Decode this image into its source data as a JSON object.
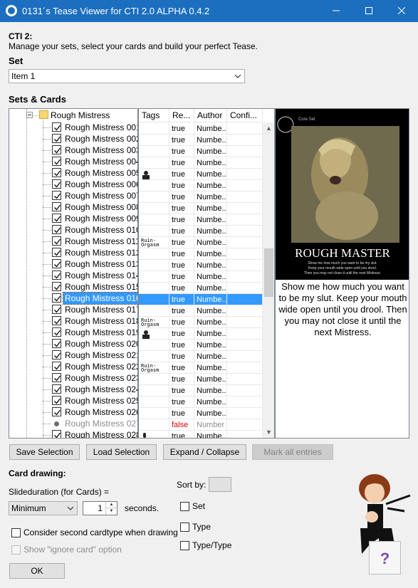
{
  "window": {
    "title": "0131´s Tease Viewer for CTI 2.0 ALPHA 0.4.2",
    "controls": [
      "minimize",
      "maximize",
      "close"
    ]
  },
  "header": {
    "heading": "CTI 2:",
    "description": "Manage your sets, select your cards and build your perfect Tease."
  },
  "set": {
    "label": "Set",
    "selected": "Item 1"
  },
  "sets_cards": {
    "label": "Sets & Cards",
    "folder": "Rough Mistress",
    "items": [
      {
        "label": "Rough Mistress 001",
        "checked": true
      },
      {
        "label": "Rough Mistress 002",
        "checked": true
      },
      {
        "label": "Rough Mistress 003",
        "checked": true
      },
      {
        "label": "Rough Mistress 004",
        "checked": true
      },
      {
        "label": "Rough Mistress 005",
        "checked": true
      },
      {
        "label": "Rough Mistress 006",
        "checked": true
      },
      {
        "label": "Rough Mistress 007",
        "checked": true
      },
      {
        "label": "Rough Mistress 008",
        "checked": true
      },
      {
        "label": "Rough Mistress 009",
        "checked": true
      },
      {
        "label": "Rough Mistress 010",
        "checked": true
      },
      {
        "label": "Rough Mistress 011",
        "checked": true
      },
      {
        "label": "Rough Mistress 012",
        "checked": true
      },
      {
        "label": "Rough Mistress 013",
        "checked": true
      },
      {
        "label": "Rough Mistress 014",
        "checked": true
      },
      {
        "label": "Rough Mistress 015",
        "checked": true
      },
      {
        "label": "Rough Mistress 016",
        "checked": true,
        "selected": true
      },
      {
        "label": "Rough Mistress 017",
        "checked": true
      },
      {
        "label": "Rough Mistress 018",
        "checked": true
      },
      {
        "label": "Rough Mistress 019",
        "checked": true
      },
      {
        "label": "Rough Mistress 020",
        "checked": true
      },
      {
        "label": "Rough Mistress 021",
        "checked": true
      },
      {
        "label": "Rough Mistress 022",
        "checked": true
      },
      {
        "label": "Rough Mistress 023",
        "checked": true
      },
      {
        "label": "Rough Mistress 024",
        "checked": true
      },
      {
        "label": "Rough Mistress 025",
        "checked": true
      },
      {
        "label": "Rough Mistress 026",
        "checked": true
      },
      {
        "label": "Rough Mistress 027",
        "checked": false,
        "disabled": true
      },
      {
        "label": "Rough Mistress 028",
        "checked": true
      }
    ]
  },
  "grid": {
    "columns": [
      "Tags",
      "Re...",
      "Author",
      "Confi..."
    ],
    "rows": [
      {
        "tag": "",
        "rep": "true",
        "author": "Numbe..."
      },
      {
        "tag": "",
        "rep": "true",
        "author": "Numbe..."
      },
      {
        "tag": "",
        "rep": "true",
        "author": "Numbe..."
      },
      {
        "tag": "",
        "rep": "true",
        "author": "Numbe..."
      },
      {
        "tag": "person-icon",
        "rep": "true",
        "author": "Numbe..."
      },
      {
        "tag": "",
        "rep": "true",
        "author": "Numbe..."
      },
      {
        "tag": "",
        "rep": "true",
        "author": "Numbe..."
      },
      {
        "tag": "",
        "rep": "true",
        "author": "Numbe..."
      },
      {
        "tag": "",
        "rep": "true",
        "author": "Numbe..."
      },
      {
        "tag": "",
        "rep": "true",
        "author": "Numbe..."
      },
      {
        "tag": "ruin-orgasm-icon",
        "rep": "true",
        "author": "Numbe..."
      },
      {
        "tag": "",
        "rep": "true",
        "author": "Numbe..."
      },
      {
        "tag": "",
        "rep": "true",
        "author": "Numbe..."
      },
      {
        "tag": "",
        "rep": "true",
        "author": "Numbe..."
      },
      {
        "tag": "",
        "rep": "true",
        "author": "Numbe..."
      },
      {
        "tag": "",
        "rep": "true",
        "author": "Numbe...",
        "selected": true
      },
      {
        "tag": "",
        "rep": "true",
        "author": "Numbe..."
      },
      {
        "tag": "ruin-orgasm-icon",
        "rep": "true",
        "author": "Numbe..."
      },
      {
        "tag": "person-icon",
        "rep": "true",
        "author": "Numbe..."
      },
      {
        "tag": "",
        "rep": "true",
        "author": "Numbe..."
      },
      {
        "tag": "",
        "rep": "true",
        "author": "Numbe..."
      },
      {
        "tag": "ruin-orgasm-icon",
        "rep": "true",
        "author": "Numbe..."
      },
      {
        "tag": "",
        "rep": "true",
        "author": "Numbe..."
      },
      {
        "tag": "",
        "rep": "true",
        "author": "Numbe..."
      },
      {
        "tag": "",
        "rep": "true",
        "author": "Numbe..."
      },
      {
        "tag": "",
        "rep": "true",
        "author": "Numbe..."
      },
      {
        "tag": "",
        "rep": "false",
        "author": "Number",
        "disabled": true
      },
      {
        "tag": "microphone-icon",
        "rep": "true",
        "author": "Numbe..."
      }
    ],
    "ruin_tag_text": "Ruin-\nOrgasm"
  },
  "preview": {
    "card_set_line": "Core Set",
    "card_title": "ROUGH MASTER",
    "card_caption": "Show me how much you want to be my slut. Keep your mouth wide open until you drool. Then you may not close it until the next Mistress.",
    "description": "Show me how much you want to be my slut. Keep your mouth wide open until you drool. Then you may not close it until the next Mistress."
  },
  "buttons": {
    "save": "Save Selection",
    "load": "Load Selection",
    "expand": "Expand / Collapse",
    "mark_all": "Mark all entries",
    "ok": "OK"
  },
  "drawing": {
    "heading": "Card drawing:",
    "slide_label": "Slideduration (for Cards) =",
    "mode": "Minimum",
    "seconds_value": "1",
    "seconds_label": "seconds.",
    "second_cardtype": "Consider second cardtype when drawing",
    "ignore_option": "Show \"ignore card\" option",
    "sort_by": "Sort by:",
    "sort_set": "Set",
    "sort_type": "Type",
    "sort_typetype": "Type/Type",
    "help": "?"
  },
  "colors": {
    "titlebar": "#1c6fbf",
    "selection": "#3399ff",
    "false_text": "#e00000",
    "card_background": "#000000",
    "help_mark": "#7b4bb5"
  }
}
